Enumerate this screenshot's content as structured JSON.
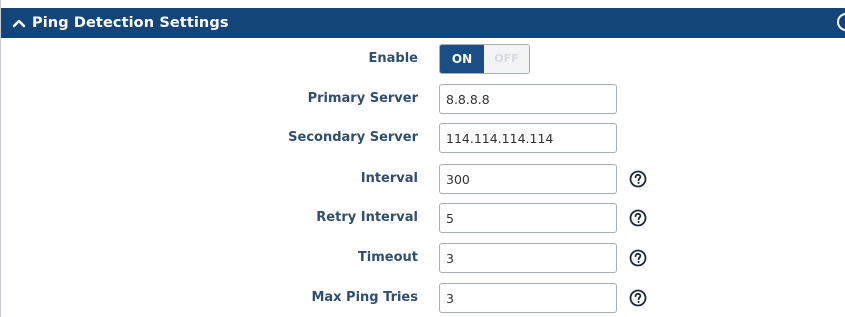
{
  "section": {
    "title": "Ping Detection Settings",
    "collapse_icon": "chevron-up-icon"
  },
  "enable": {
    "label": "Enable",
    "on_label": "ON",
    "off_label": "OFF",
    "state": "on"
  },
  "primary_server": {
    "label": "Primary Server",
    "value": "8.8.8.8"
  },
  "secondary_server": {
    "label": "Secondary Server",
    "value": "114.114.114.114"
  },
  "interval": {
    "label": "Interval",
    "value": "300"
  },
  "retry_interval": {
    "label": "Retry Interval",
    "value": "5"
  },
  "timeout": {
    "label": "Timeout",
    "value": "3"
  },
  "max_ping_tries": {
    "label": "Max Ping Tries",
    "value": "3"
  },
  "colors": {
    "header_bg": "#14457a",
    "label_text": "#2f4f6f",
    "toggle_on": "#1b4e85"
  }
}
